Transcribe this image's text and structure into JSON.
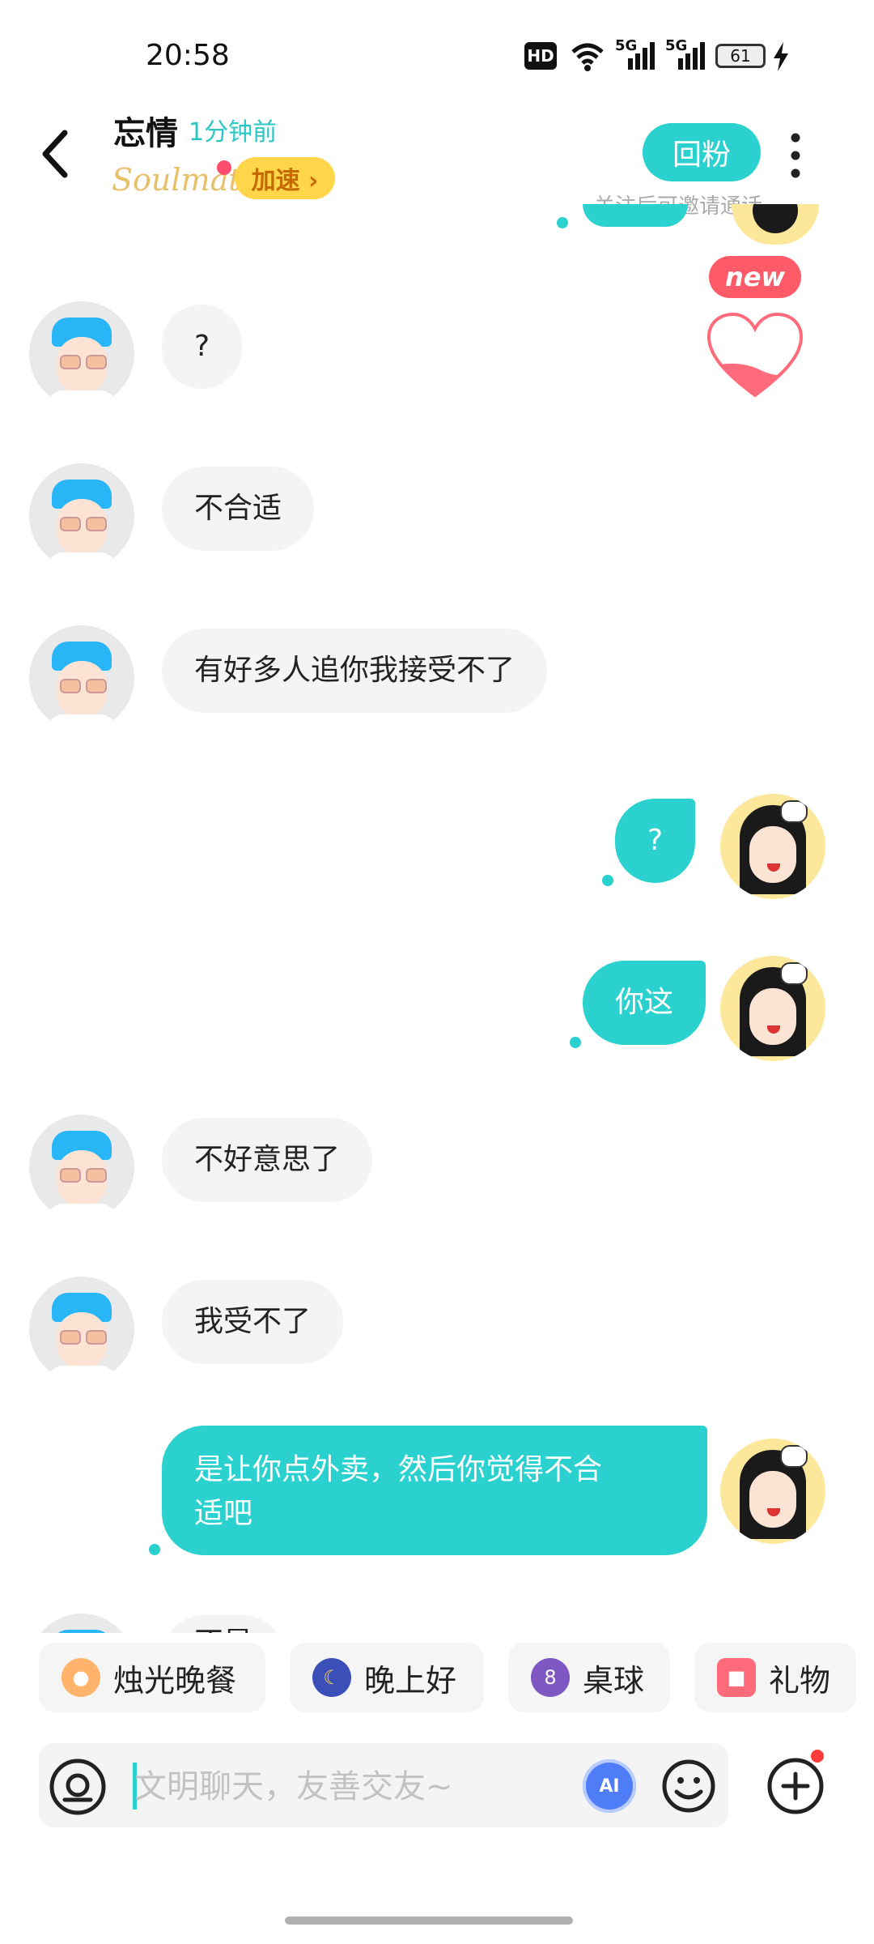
{
  "status_bar": {
    "time": "20:58",
    "hd_label": "HD",
    "net1": "5G",
    "net2": "5G",
    "battery": "61"
  },
  "header": {
    "contact_name": "忘情",
    "last_seen": "1分钟前",
    "soulmate_logo": "Soulmate",
    "speed_button": "加速 ›",
    "follow_button": "回粉",
    "follow_hint": "关注后可邀请通话",
    "new_badge": "new"
  },
  "messages": [
    {
      "side": "left",
      "text": "?"
    },
    {
      "side": "left",
      "text": "不合适"
    },
    {
      "side": "left",
      "text": "有好多人追你我接受不了"
    },
    {
      "side": "right",
      "text": "?"
    },
    {
      "side": "right",
      "text": "你这"
    },
    {
      "side": "left",
      "text": "不好意思了"
    },
    {
      "side": "left",
      "text": "我受不了"
    },
    {
      "side": "right",
      "text": "是让你点外卖，然后你觉得不合适吧",
      "line1": "是让你点外卖，然后你觉得不合",
      "line2": "适吧"
    },
    {
      "side": "left",
      "text": "不是"
    }
  ],
  "quick_replies": [
    {
      "label": "烛光晚餐",
      "icon": "dinner-icon"
    },
    {
      "label": "晚上好",
      "icon": "moon-icon"
    },
    {
      "label": "桌球",
      "icon": "billiard-ball-icon",
      "glyph": "8"
    },
    {
      "label": "礼物",
      "icon": "gift-icon"
    }
  ],
  "input": {
    "placeholder": "文明聊天，友善交友~",
    "ai_label": "AI"
  },
  "colors": {
    "accent": "#2ad1cf",
    "badge_red": "#ff4d6d",
    "speed_yellow": "#ffd54a"
  }
}
